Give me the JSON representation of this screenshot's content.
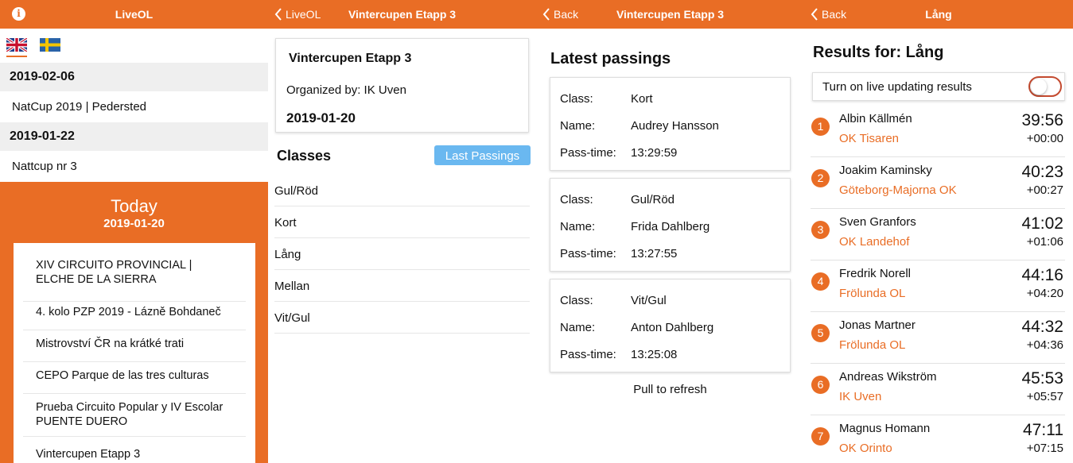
{
  "panel1": {
    "nav_title": "LiveOL",
    "dates": [
      {
        "date": "2019-02-06",
        "events": [
          "NatCup 2019 | Pedersted"
        ]
      },
      {
        "date": "2019-01-22",
        "events": [
          "Nattcup nr 3"
        ]
      }
    ],
    "today_title": "Today",
    "today_date": "2019-01-20",
    "today_events": [
      "XIV CIRCUITO PROVINCIAL | ELCHE DE LA SIERRA",
      "4. kolo PZP 2019 - Lázně Bohdaneč",
      "Mistrovství ČR na krátké trati",
      "CEPO Parque de las tres culturas",
      "Prueba Circuito Popular y IV Escolar PUENTE DUERO",
      "Vintercupen Etapp 3"
    ]
  },
  "panel2": {
    "back_label": "LiveOL",
    "nav_title": "Vintercupen Etapp 3",
    "competition_name": "Vintercupen Etapp 3",
    "organizer": "Organized by: IK Uven",
    "date": "2019-01-20",
    "classes_title": "Classes",
    "last_passings_button": "Last Passings",
    "classes": [
      "Gul/Röd",
      "Kort",
      "Lång",
      "Mellan",
      "Vit/Gul"
    ]
  },
  "panel3": {
    "back_label": "Back",
    "nav_title": "Vintercupen Etapp 3",
    "title": "Latest passings",
    "labels": {
      "class": "Class:",
      "name": "Name:",
      "time": "Pass-time:"
    },
    "passings": [
      {
        "class": "Kort",
        "name": "Audrey Hansson",
        "time": "13:29:59"
      },
      {
        "class": "Gul/Röd",
        "name": "Frida Dahlberg",
        "time": "13:27:55"
      },
      {
        "class": "Vit/Gul",
        "name": "Anton Dahlberg",
        "time": "13:25:08"
      }
    ],
    "pull_to_refresh": "Pull to refresh"
  },
  "panel4": {
    "back_label": "Back",
    "nav_title": "Lång",
    "title": "Results for: Lång",
    "live_toggle_label": "Turn on live updating results",
    "live_toggle_on": false,
    "results": [
      {
        "place": "1",
        "name": "Albin Källmén",
        "club": "OK Tisaren",
        "time": "39:56",
        "diff": "+00:00"
      },
      {
        "place": "2",
        "name": "Joakim Kaminsky",
        "club": "Göteborg-Majorna OK",
        "time": "40:23",
        "diff": "+00:27"
      },
      {
        "place": "3",
        "name": "Sven Granfors",
        "club": "OK Landehof",
        "time": "41:02",
        "diff": "+01:06"
      },
      {
        "place": "4",
        "name": "Fredrik Norell",
        "club": "Frölunda OL",
        "time": "44:16",
        "diff": "+04:20"
      },
      {
        "place": "5",
        "name": "Jonas Martner",
        "club": "Frölunda OL",
        "time": "44:32",
        "diff": "+04:36"
      },
      {
        "place": "6",
        "name": "Andreas Wikström",
        "club": "IK Uven",
        "time": "45:53",
        "diff": "+05:57"
      },
      {
        "place": "7",
        "name": "Magnus Homann",
        "club": "OK Orinto",
        "time": "47:11",
        "diff": "+07:15"
      }
    ]
  },
  "colors": {
    "accent": "#e96d25",
    "button_blue": "#6ab8f0",
    "toggle_border": "#c44a2f"
  }
}
